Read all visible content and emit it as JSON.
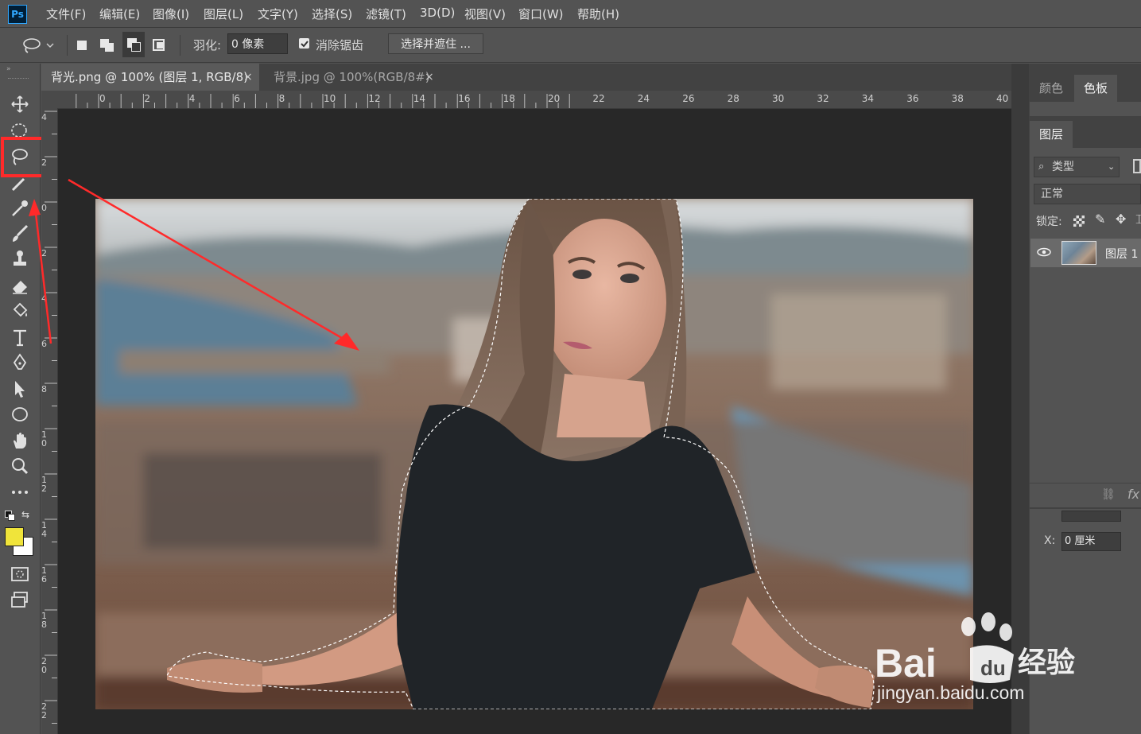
{
  "app": {
    "logo": "Ps"
  },
  "menu": [
    "文件(F)",
    "编辑(E)",
    "图像(I)",
    "图层(L)",
    "文字(Y)",
    "选择(S)",
    "滤镜(T)",
    "3D(D)",
    "视图(V)",
    "窗口(W)",
    "帮助(H)"
  ],
  "options": {
    "feather_label": "羽化:",
    "feather_value": "0 像素",
    "antialias_label": "消除锯齿",
    "antialias_checked": true,
    "select_mask_label": "选择并遮住 ..."
  },
  "tabs": [
    {
      "label": "背光.png @ 100% (图层 1, RGB/8)",
      "close": "×",
      "active": true
    },
    {
      "label": "背景.jpg @ 100%(RGB/8#)",
      "close": "×",
      "active": false
    }
  ],
  "ruler_h": [
    "0",
    "2",
    "4",
    "6",
    "8",
    "10",
    "12",
    "14",
    "16",
    "18",
    "20",
    "22",
    "24",
    "26",
    "28",
    "30",
    "32",
    "34",
    "36",
    "38",
    "40"
  ],
  "ruler_v": [
    "4",
    "2",
    "0",
    "2",
    "4",
    "6",
    "8",
    "1 0",
    "1 2",
    "1 4",
    "1 6",
    "1 8",
    "2 0",
    "2 2"
  ],
  "tools": [
    "move-tool",
    "marquee-tool",
    "lasso-tool",
    "magic-wand-tool",
    "eyedropper-tool",
    "brush-tool",
    "stamp-tool",
    "eraser-tool",
    "paint-bucket-tool",
    "type-tool",
    "pen-tool",
    "path-select-tool",
    "ellipse-tool",
    "hand-tool",
    "zoom-tool",
    "more-tools"
  ],
  "colors": {
    "foreground": "#f0e43a",
    "background": "#ffffff",
    "highlight": "#ff2a2a"
  },
  "right": {
    "top_tabs": [
      "颜色",
      "色板"
    ],
    "layers_tab": "图层",
    "kind_filter": "类型",
    "blend_mode": "正常",
    "lock_label": "锁定:",
    "layer_name": "图层 1",
    "fx_label": "fx",
    "x_label": "X:",
    "x_value": "0 厘米"
  },
  "watermark": {
    "brand": "Bai",
    "brand2": "经验",
    "site": "jingyan.baidu.com"
  }
}
